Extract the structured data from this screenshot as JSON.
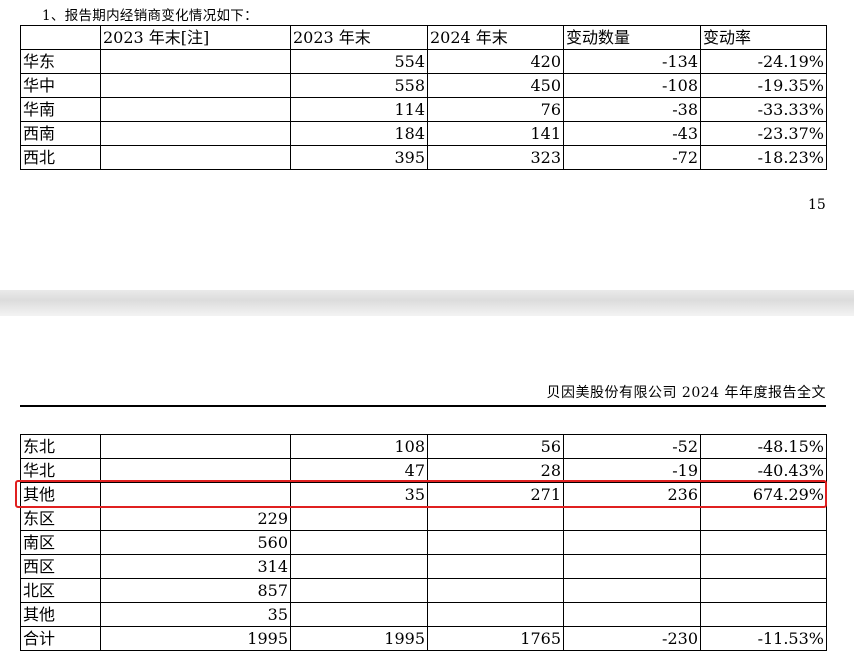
{
  "intro": "1、报告期内经销商变化情况如下：",
  "page_number": "15",
  "running_header": "贝因美股份有限公司 2024 年年度报告全文",
  "headers": [
    "",
    "2023 年末[注]",
    "2023 年末",
    "2024 年末",
    "变动数量",
    "变动率"
  ],
  "table1_rows": [
    [
      "华东",
      "",
      "554",
      "420",
      "-134",
      "-24.19%"
    ],
    [
      "华中",
      "",
      "558",
      "450",
      "-108",
      "-19.35%"
    ],
    [
      "华南",
      "",
      "114",
      "76",
      "-38",
      "-33.33%"
    ],
    [
      "西南",
      "",
      "184",
      "141",
      "-43",
      "-23.37%"
    ],
    [
      "西北",
      "",
      "395",
      "323",
      "-72",
      "-18.23%"
    ]
  ],
  "table2_rows": [
    [
      "东北",
      "",
      "108",
      "56",
      "-52",
      "-48.15%"
    ],
    [
      "华北",
      "",
      "47",
      "28",
      "-19",
      "-40.43%"
    ],
    [
      "其他",
      "",
      "35",
      "271",
      "236",
      "674.29%"
    ],
    [
      "东区",
      "229",
      "",
      "",
      "",
      ""
    ],
    [
      "南区",
      "560",
      "",
      "",
      "",
      ""
    ],
    [
      "西区",
      "314",
      "",
      "",
      "",
      ""
    ],
    [
      "北区",
      "857",
      "",
      "",
      "",
      ""
    ],
    [
      "其他",
      "35",
      "",
      "",
      "",
      ""
    ],
    [
      "合计",
      "1995",
      "1995",
      "1765",
      "-230",
      "-11.53%"
    ]
  ],
  "highlight_color": "#e02020"
}
